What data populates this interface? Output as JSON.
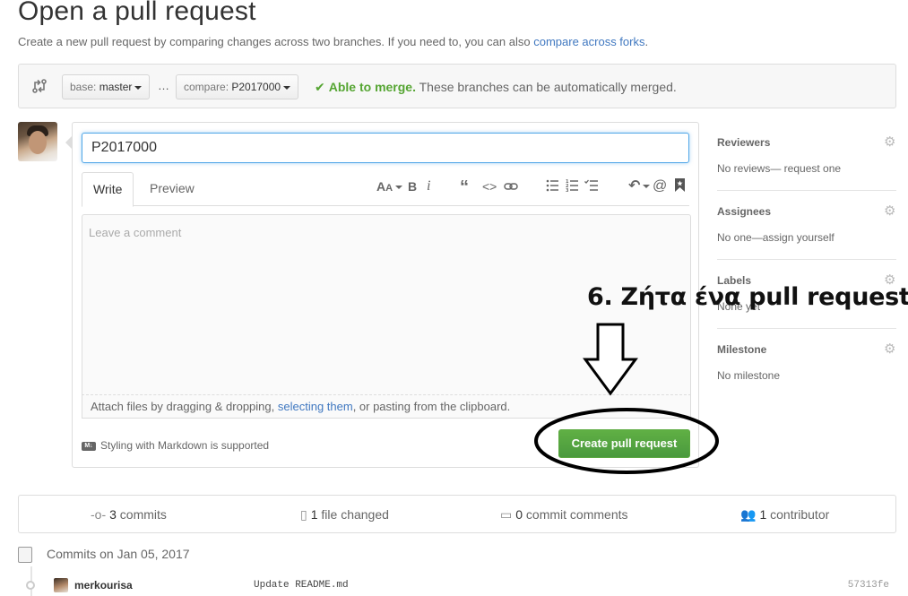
{
  "header": {
    "title": "Open a pull request",
    "subtitle": "Create a new pull request by comparing changes across two branches. If you need to, you can also ",
    "subtitle_link": "compare across forks",
    "subtitle_end": "."
  },
  "range": {
    "base_label": "base: ",
    "base_value": "master",
    "ellipsis": "…",
    "compare_label": "compare: ",
    "compare_value": "P2017000",
    "merge_ok": "Able to merge.",
    "merge_text": " These branches can be automatically merged."
  },
  "composer": {
    "title_value": "P2017000",
    "tabs": [
      "Write",
      "Preview"
    ],
    "comment_placeholder": "Leave a comment",
    "attach_prefix": "Attach files by dragging & dropping, ",
    "attach_link": "selecting them",
    "attach_suffix": ", or pasting from the clipboard.",
    "markdown_note": "Styling with Markdown is supported",
    "create_button": "Create pull request",
    "toolbar_icons": [
      "text-size-icon",
      "bold-icon",
      "italic-icon",
      "quote-icon",
      "code-icon",
      "link-icon",
      "bulleted-list-icon",
      "numbered-list-icon",
      "task-list-icon",
      "reply-icon",
      "mention-icon",
      "bookmark-icon"
    ]
  },
  "sidebar": {
    "sections": [
      {
        "title": "Reviewers",
        "value": "No reviews— request one"
      },
      {
        "title": "Assignees",
        "value": "No one—assign yourself"
      },
      {
        "title": "Labels",
        "value": "None yet"
      },
      {
        "title": "Milestone",
        "value": "No milestone"
      }
    ]
  },
  "annotation": {
    "text": "6. Ζήτα ένα pull request"
  },
  "summary": {
    "commits_count": "3",
    "commits_label": " commits",
    "files_count": "1",
    "files_label": " file changed",
    "comments_count": "0",
    "comments_label": " commit comments",
    "contributors_count": "1",
    "contributors_label": " contributor"
  },
  "commits": {
    "header": "Commits on Jan 05, 2017",
    "rows": [
      {
        "author": "merkourisa",
        "message": "Update README.md",
        "sha": "57313fe"
      }
    ]
  },
  "colors": {
    "accent_link": "#4078c0",
    "merge_green": "#55a532",
    "button_green": "#5ca941",
    "focus_blue": "#51a7e8"
  }
}
